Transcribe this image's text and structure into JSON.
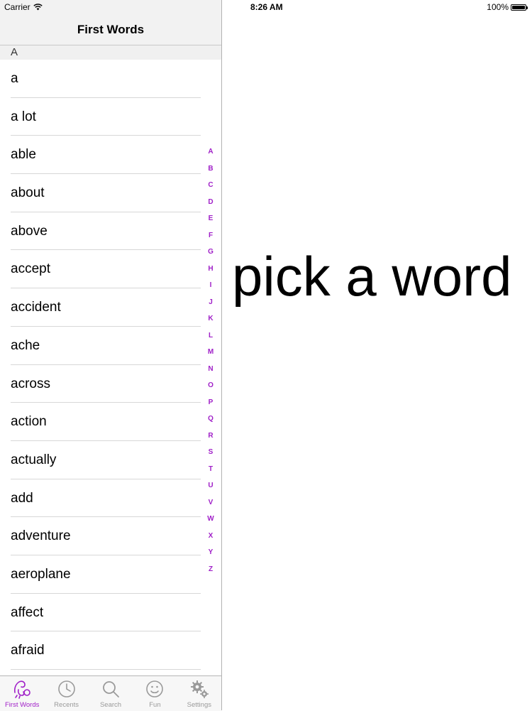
{
  "status": {
    "carrier": "Carrier",
    "time": "8:26 AM",
    "battery": "100%",
    "battery_level": 1.0
  },
  "nav": {
    "title": "First Words"
  },
  "section": {
    "header": "A"
  },
  "words": [
    "a",
    "a lot",
    "able",
    "about",
    "above",
    "accept",
    "accident",
    "ache",
    "across",
    "action",
    "actually",
    "add",
    "adventure",
    "aeroplane",
    "affect",
    "afraid"
  ],
  "index": [
    "A",
    "B",
    "C",
    "D",
    "E",
    "F",
    "G",
    "H",
    "I",
    "J",
    "K",
    "L",
    "M",
    "N",
    "O",
    "P",
    "Q",
    "R",
    "S",
    "T",
    "U",
    "V",
    "W",
    "X",
    "Y",
    "Z"
  ],
  "tabs": [
    {
      "label": "First Words",
      "icon": "first-words-icon",
      "active": true
    },
    {
      "label": "Recents",
      "icon": "clock-icon",
      "active": false
    },
    {
      "label": "Search",
      "icon": "search-icon",
      "active": false
    },
    {
      "label": "Fun",
      "icon": "smiley-icon",
      "active": false
    },
    {
      "label": "Settings",
      "icon": "gear-icon",
      "active": false
    }
  ],
  "detail": {
    "message": "pick a word"
  },
  "colors": {
    "accent": "#a020c8",
    "inactive_tab": "#9a9a9a",
    "nav_bg": "#f2f2f2"
  }
}
